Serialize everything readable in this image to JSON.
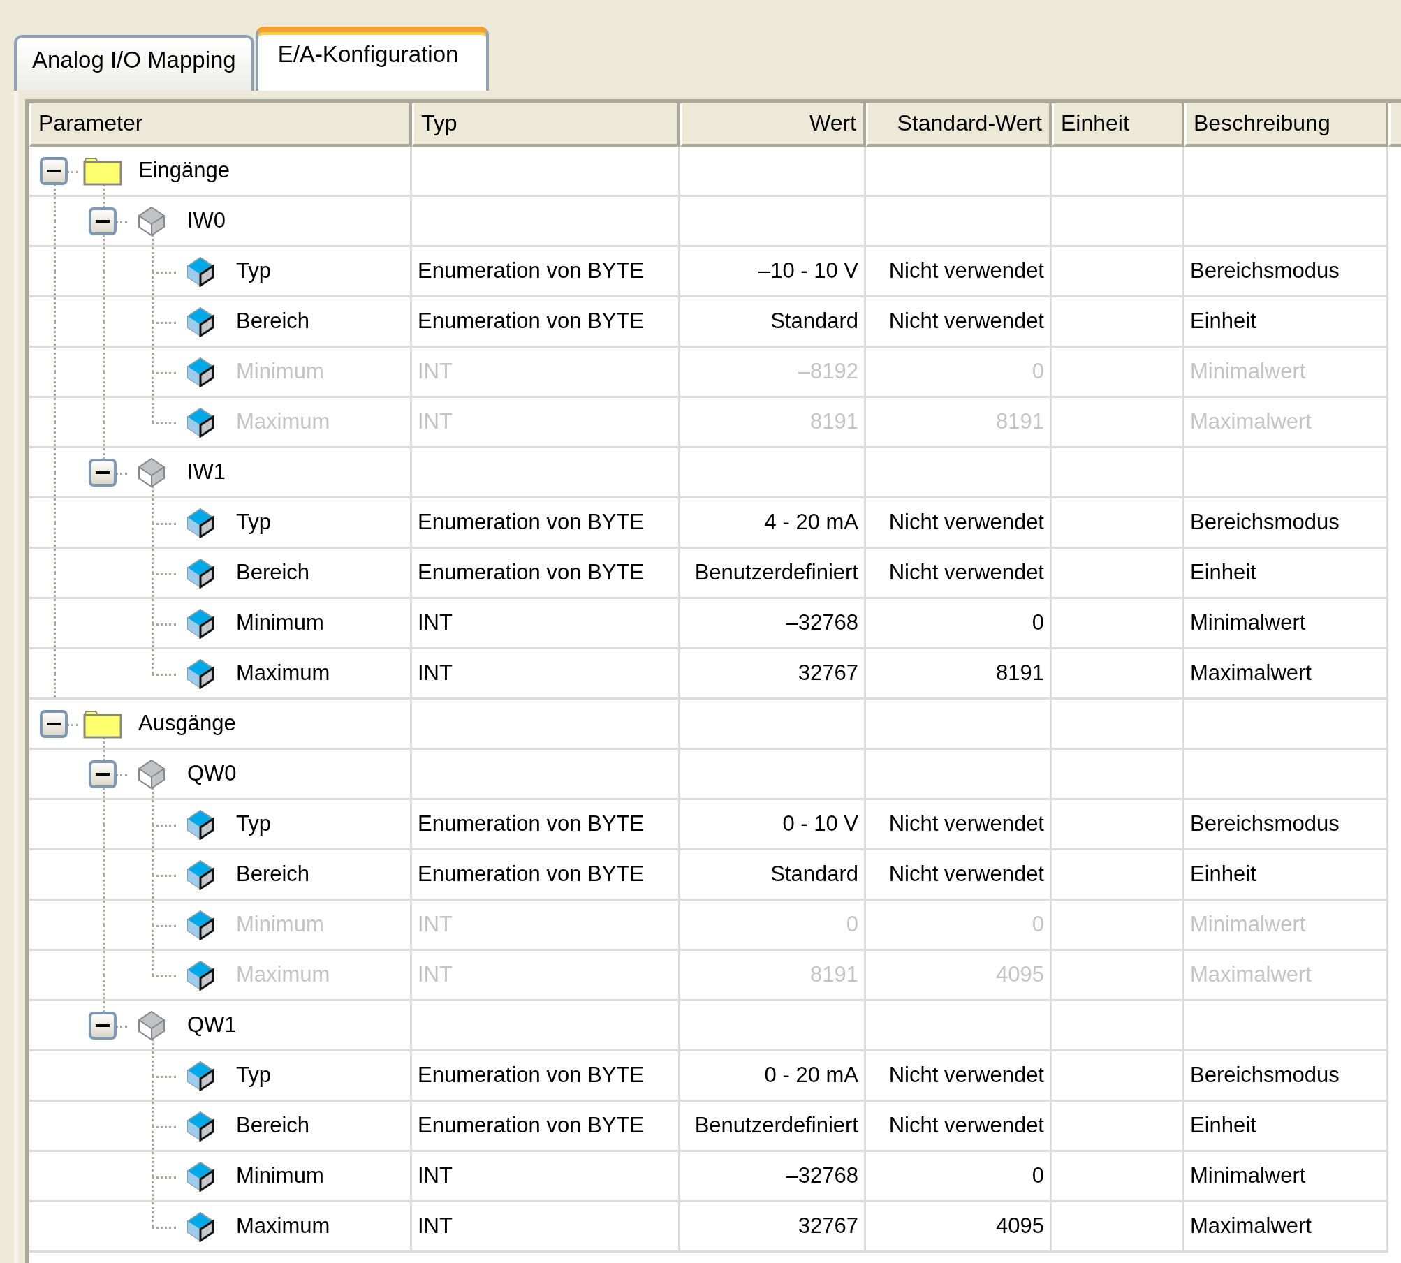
{
  "tabs": [
    {
      "label": "Analog I/O Mapping",
      "selected": false
    },
    {
      "label": "E/A-Konfiguration",
      "selected": true
    }
  ],
  "table": {
    "columns": [
      "Parameter",
      "Typ",
      "Wert",
      "Standard-Wert",
      "Einheit",
      "Beschreibung"
    ],
    "tree": [
      {
        "kind": "folder",
        "name": "Eingänge",
        "expanded": true,
        "children": [
          {
            "kind": "channel",
            "name": "IW0",
            "expanded": true,
            "children": [
              {
                "kind": "parameter",
                "name": "Typ",
                "type": "Enumeration von BYTE",
                "value": "–10 - 10 V",
                "default": "Nicht verwendet",
                "description": "Bereichsmodus",
                "disabled": false
              },
              {
                "kind": "parameter",
                "name": "Bereich",
                "type": "Enumeration von BYTE",
                "value": "Standard",
                "default": "Nicht verwendet",
                "description": "Einheit",
                "disabled": false
              },
              {
                "kind": "parameter",
                "name": "Minimum",
                "type": "INT",
                "value": "–8192",
                "default": "0",
                "description": "Minimalwert",
                "disabled": true
              },
              {
                "kind": "parameter",
                "name": "Maximum",
                "type": "INT",
                "value": "8191",
                "default": "8191",
                "description": "Maximalwert",
                "disabled": true
              }
            ]
          },
          {
            "kind": "channel",
            "name": "IW1",
            "expanded": true,
            "children": [
              {
                "kind": "parameter",
                "name": "Typ",
                "type": "Enumeration von BYTE",
                "value": "4 - 20 mA",
                "default": "Nicht verwendet",
                "description": "Bereichsmodus",
                "disabled": false
              },
              {
                "kind": "parameter",
                "name": "Bereich",
                "type": "Enumeration von BYTE",
                "value": "Benutzerdefiniert",
                "default": "Nicht verwendet",
                "description": "Einheit",
                "disabled": false
              },
              {
                "kind": "parameter",
                "name": "Minimum",
                "type": "INT",
                "value": "–32768",
                "default": "0",
                "description": "Minimalwert",
                "disabled": false
              },
              {
                "kind": "parameter",
                "name": "Maximum",
                "type": "INT",
                "value": "32767",
                "default": "8191",
                "description": "Maximalwert",
                "disabled": false
              }
            ]
          }
        ]
      },
      {
        "kind": "folder",
        "name": "Ausgänge",
        "expanded": true,
        "children": [
          {
            "kind": "channel",
            "name": "QW0",
            "expanded": true,
            "children": [
              {
                "kind": "parameter",
                "name": "Typ",
                "type": "Enumeration von BYTE",
                "value": "0 - 10 V",
                "default": "Nicht verwendet",
                "description": "Bereichsmodus",
                "disabled": false
              },
              {
                "kind": "parameter",
                "name": "Bereich",
                "type": "Enumeration von BYTE",
                "value": "Standard",
                "default": "Nicht verwendet",
                "description": "Einheit",
                "disabled": false
              },
              {
                "kind": "parameter",
                "name": "Minimum",
                "type": "INT",
                "value": "0",
                "default": "0",
                "description": "Minimalwert",
                "disabled": true
              },
              {
                "kind": "parameter",
                "name": "Maximum",
                "type": "INT",
                "value": "8191",
                "default": "4095",
                "description": "Maximalwert",
                "disabled": true
              }
            ]
          },
          {
            "kind": "channel",
            "name": "QW1",
            "expanded": true,
            "children": [
              {
                "kind": "parameter",
                "name": "Typ",
                "type": "Enumeration von BYTE",
                "value": "0 - 20 mA",
                "default": "Nicht verwendet",
                "description": "Bereichsmodus",
                "disabled": false
              },
              {
                "kind": "parameter",
                "name": "Bereich",
                "type": "Enumeration von BYTE",
                "value": "Benutzerdefiniert",
                "default": "Nicht verwendet",
                "description": "Einheit",
                "disabled": false
              },
              {
                "kind": "parameter",
                "name": "Minimum",
                "type": "INT",
                "value": "–32768",
                "default": "0",
                "description": "Minimalwert",
                "disabled": false
              },
              {
                "kind": "parameter",
                "name": "Maximum",
                "type": "INT",
                "value": "32767",
                "default": "4095",
                "description": "Maximalwert",
                "disabled": false
              }
            ]
          }
        ]
      }
    ]
  }
}
